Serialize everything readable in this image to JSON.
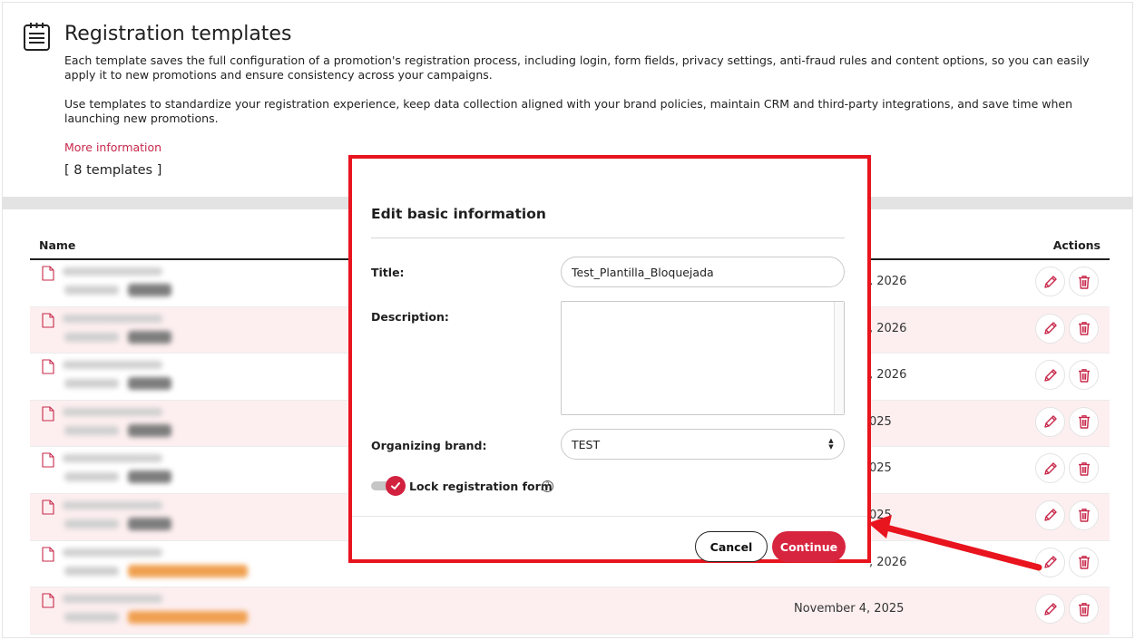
{
  "page": {
    "title": "Registration templates",
    "description_1": "Each template saves the full configuration of a promotion's registration process, including login, form fields, privacy settings, anti-fraud rules and content options, so you can easily apply it to new promotions and ensure consistency across your campaigns.",
    "description_2": "Use templates to standardize your registration experience, keep data collection aligned with your brand policies, maintain CRM and third-party integrations, and save time when launching new promotions.",
    "more_info": "More information",
    "count": "[ 8 templates ]"
  },
  "table": {
    "headers": {
      "name": "Name",
      "actions": "Actions"
    },
    "rows": [
      {
        "date": ", 2026"
      },
      {
        "date": ", 2026"
      },
      {
        "date": ", 2026"
      },
      {
        "date": "025"
      },
      {
        "date": "025"
      },
      {
        "date": "025"
      },
      {
        "date": ", 2026"
      },
      {
        "date": "November 4, 2025"
      }
    ]
  },
  "modal": {
    "title": "Edit basic information",
    "title_label": "Title:",
    "title_value": "Test_Plantilla_Bloquejada",
    "description_label": "Description:",
    "description_value": "",
    "brand_label": "Organizing brand:",
    "brand_value": "TEST",
    "lock_label": "Lock registration form",
    "lock_enabled": true,
    "help_glyph": "?",
    "cancel": "Cancel",
    "continue": "Continue"
  },
  "colors": {
    "accent": "#d8253f",
    "annotation": "#e8141e",
    "link": "#c8284a",
    "row_alt": "#fdeff0"
  },
  "icons": {
    "header": "list-clipboard-icon",
    "row": "file-icon",
    "edit": "pencil-icon",
    "delete": "trash-icon",
    "toggle": "check-icon",
    "help": "help-circle-icon"
  }
}
